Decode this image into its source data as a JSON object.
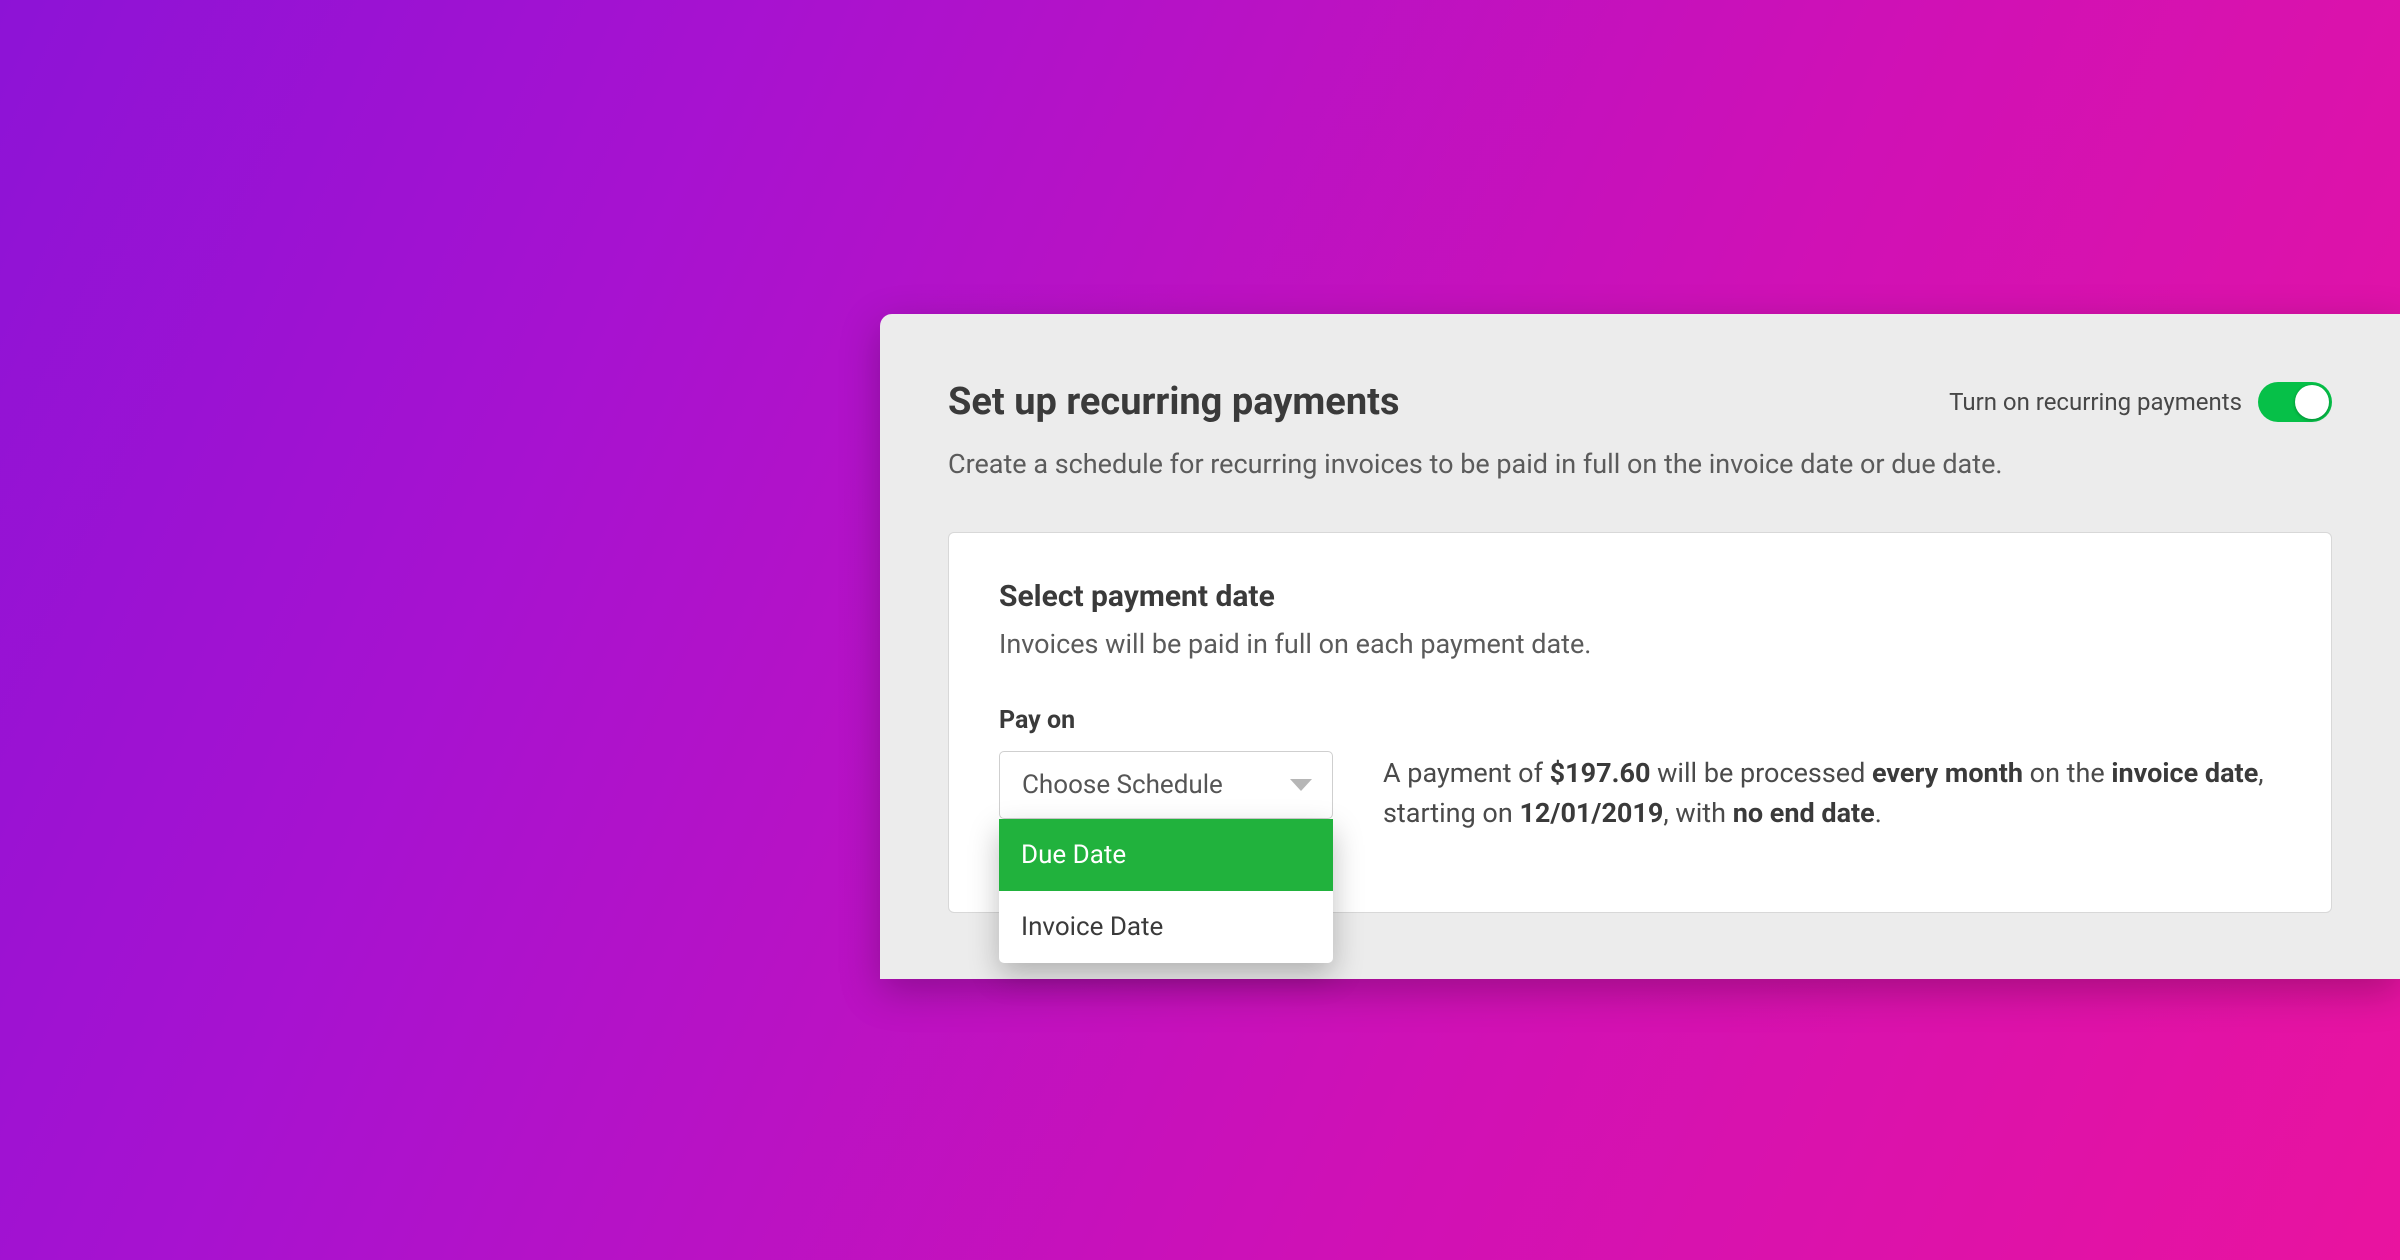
{
  "panel": {
    "title": "Set up recurring payments",
    "description": "Create a schedule for recurring invoices to be paid in full on the invoice date or due date.",
    "toggle_label": "Turn on recurring payments",
    "toggle_on": true
  },
  "card": {
    "title": "Select payment date",
    "subtitle": "Invoices will be paid in full on each payment date.",
    "field_label": "Pay on",
    "select_placeholder": "Choose Schedule",
    "options": [
      "Due Date",
      "Invoice Date"
    ],
    "highlighted_option": "Due Date"
  },
  "summary": {
    "prefix": "A payment of ",
    "amount": "$197.60",
    "mid1": " will be processed ",
    "frequency": "every month",
    "mid2": " on the ",
    "on_what": "invoice date",
    "mid3": ", starting on ",
    "start_date": "12/01/2019",
    "mid4": ", with ",
    "end_clause": "no end date",
    "suffix": "."
  },
  "colors": {
    "accent_green": "#21b23d",
    "toggle_green": "#06c048"
  }
}
